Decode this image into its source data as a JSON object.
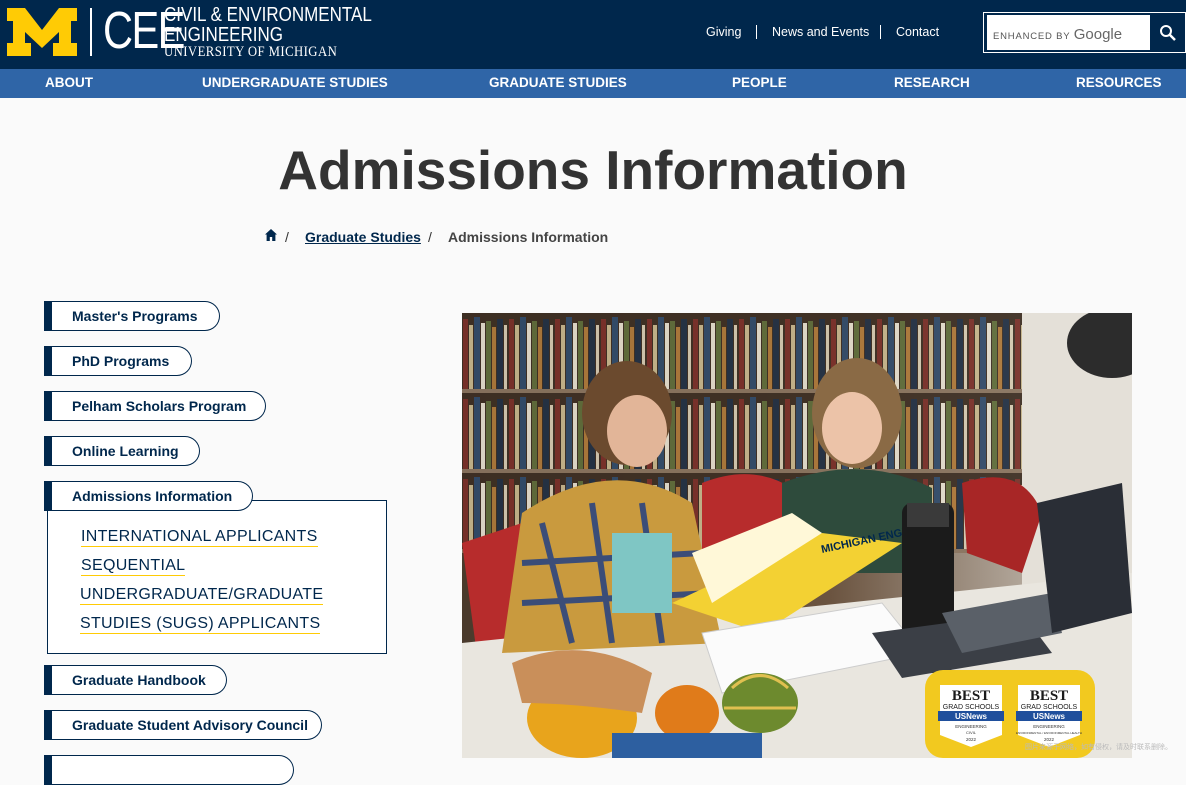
{
  "header": {
    "logo_cee": "CEE",
    "logo_line1": "CIVIL & ENVIRONMENTAL",
    "logo_line2": "ENGINEERING",
    "logo_line3": "UNIVERSITY OF MICHIGAN",
    "utility_links": [
      "Giving",
      "News and Events",
      "Contact"
    ],
    "search_placeholder_prefix": "ENHANCED BY",
    "search_placeholder_brand": "Google"
  },
  "nav": {
    "items": [
      "ABOUT",
      "UNDERGRADUATE STUDIES",
      "GRADUATE STUDIES",
      "PEOPLE",
      "RESEARCH",
      "RESOURCES"
    ]
  },
  "page": {
    "title": "Admissions Information"
  },
  "breadcrumb": {
    "sep": "/",
    "parent": "Graduate Studies",
    "current": "Admissions Information"
  },
  "sidebar": {
    "items": [
      "Master's Programs",
      "PhD Programs",
      "Pelham Scholars Program",
      "Online Learning",
      "Admissions Information",
      "Graduate Handbook",
      "Graduate Student Advisory Council"
    ],
    "sub": {
      "link1": "INTERNATIONAL APPLICANTS",
      "link2_line1": "SEQUENTIAL",
      "link2_line2": "UNDERGRADUATE/GRADUATE",
      "link2_line3": "STUDIES (SUGS) APPLICANTS"
    }
  },
  "photo": {
    "book_cover_text": "MICHIGAN ENGINEER",
    "badge1": {
      "best": "BEST",
      "grad": "GRAD SCHOOLS",
      "usnews": "USNews",
      "field": "ENGINEERING",
      "sub": "CIVIL",
      "year": "2022"
    },
    "badge2": {
      "best": "BEST",
      "grad": "GRAD SCHOOLS",
      "usnews": "USNews",
      "field": "ENGINEERING",
      "sub": "ENVIRONMENTAL / ENVIRONMENTAL HEALTH",
      "year": "2022"
    },
    "caption": "图片来源于网络，如有侵权，请及时联系删除。"
  },
  "colors": {
    "navy": "#00274c",
    "maize": "#ffcb05",
    "nav_blue": "#2f65a7"
  }
}
